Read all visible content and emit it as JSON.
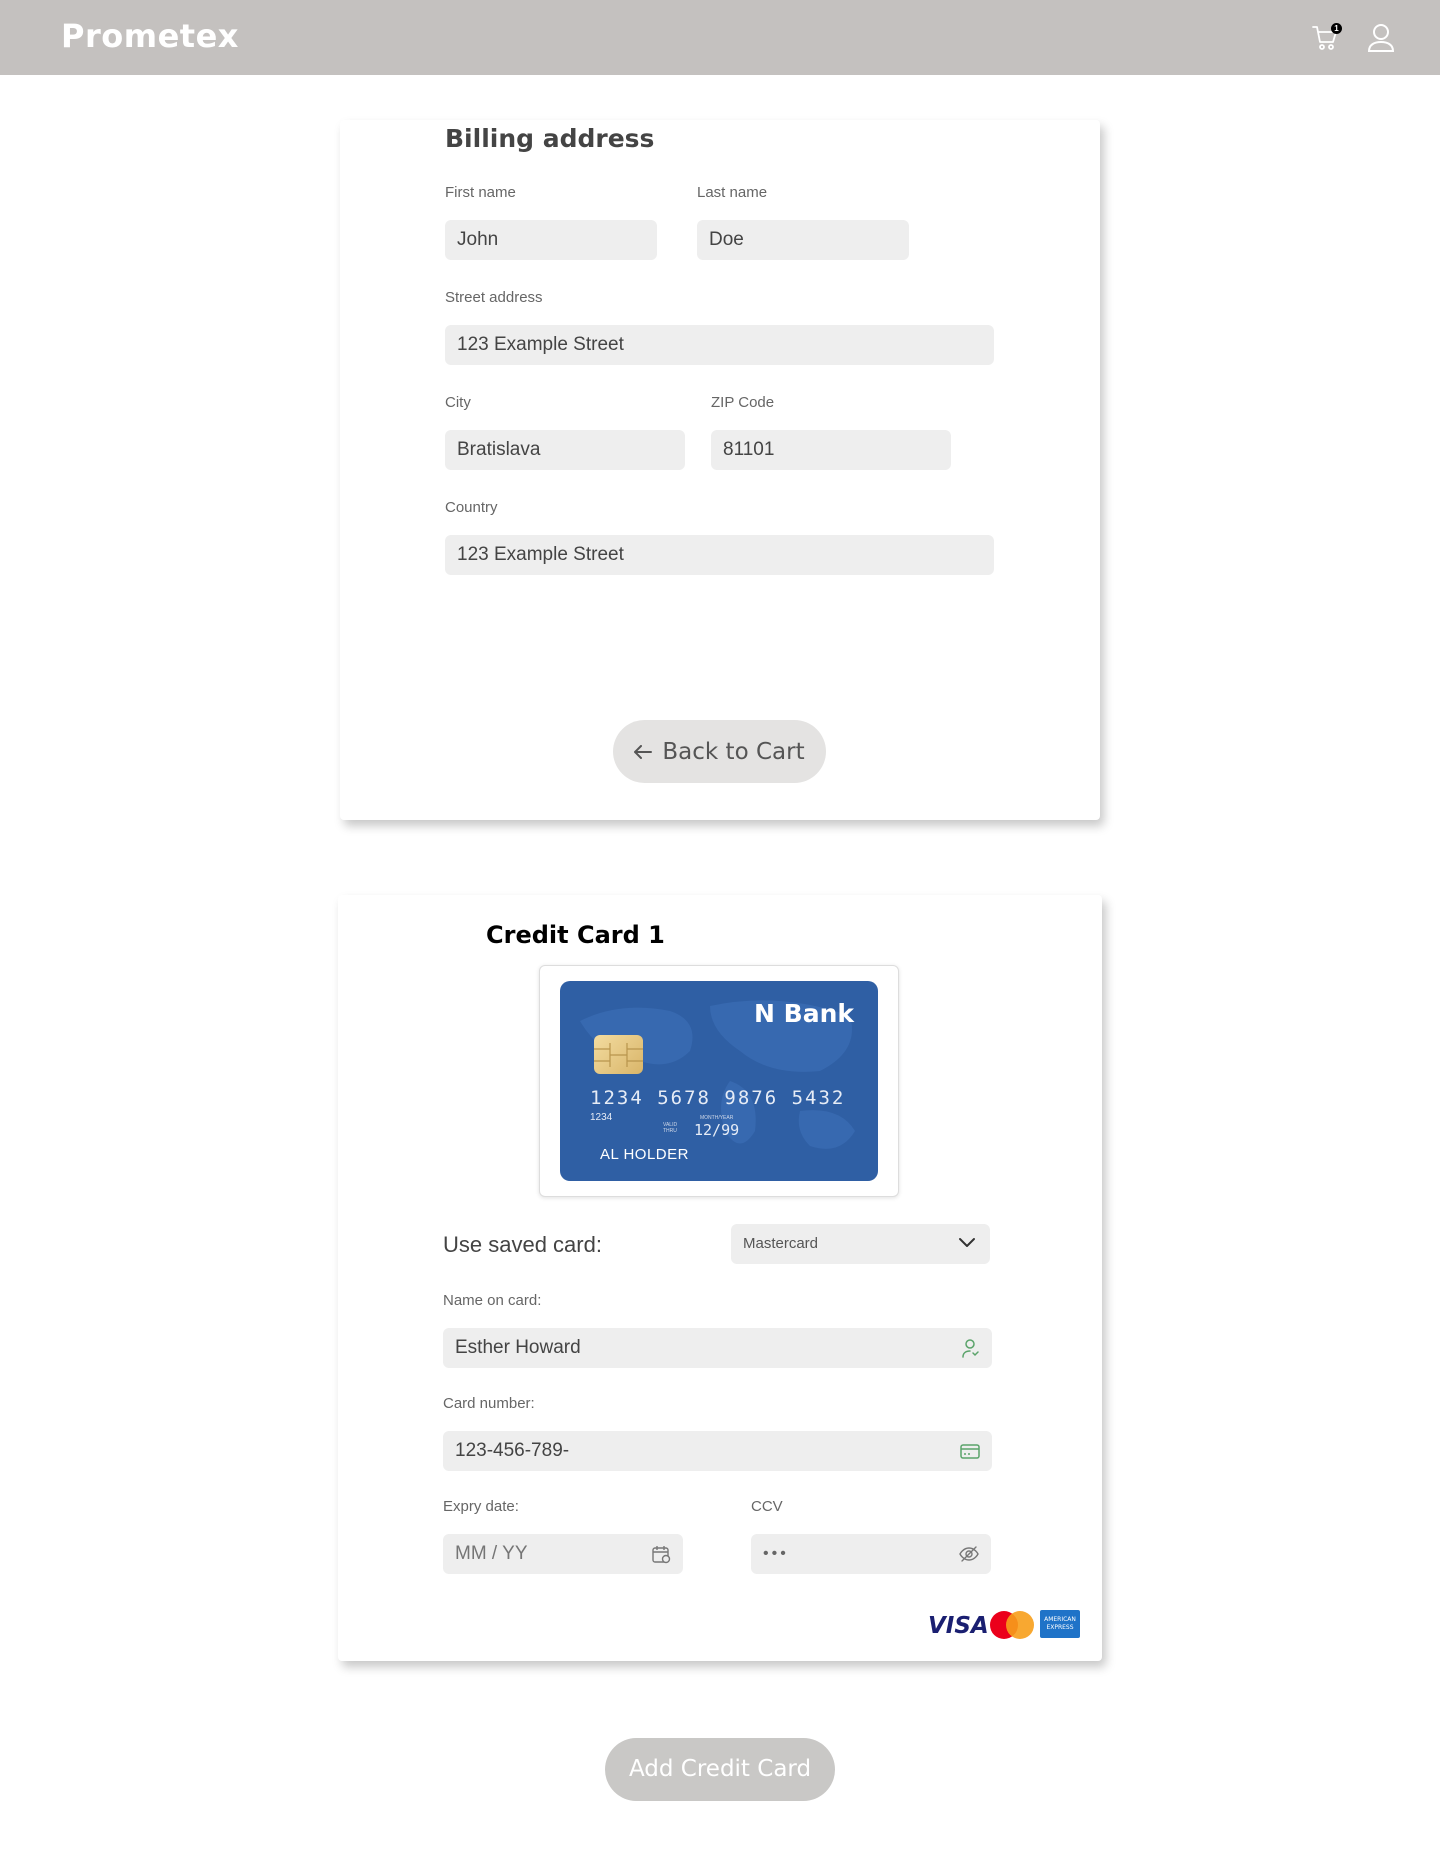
{
  "header": {
    "brand": "Prometex",
    "cart_count": "1",
    "cart_icon": "cart-icon",
    "user_icon": "user-icon"
  },
  "billing": {
    "title": "Billing address",
    "first_name_label": "First name",
    "first_name_value": "John",
    "last_name_label": "Last name",
    "last_name_value": "Doe",
    "street_label": "Street address",
    "street_value": "123 Example Street",
    "city_label": "City",
    "city_value": "Bratislava",
    "zip_label": "ZIP Code",
    "zip_value": "81101",
    "country_label": "Country",
    "country_value": "123 Example Street",
    "back_label": "Back to Cart"
  },
  "card_section": {
    "title": "Credit Card 1",
    "card_visual": {
      "bank": "N Bank",
      "number": "1234 5678 9876 5432",
      "sub_number": "1234",
      "valid_label_1": "VALID",
      "valid_label_2": "THRU",
      "month_year_label": "MONTH/YEAR",
      "expiry": "12/99",
      "holder": "AL  HOLDER"
    },
    "saved_label": "Use saved card:",
    "saved_value": "Mastercard",
    "name_label": "Name on card:",
    "name_value": "Esther Howard",
    "number_label": "Card number:",
    "number_value": "123-456-789-",
    "expiry_label": "Expry date:",
    "expiry_placeholder": "MM / YY",
    "ccv_label": "CCV",
    "ccv_value": "•••",
    "brands": {
      "visa": "VISA",
      "amex": "AMERICAN EXPRESS"
    }
  },
  "add_button": "Add Credit Card",
  "colors": {
    "topbar": "#c4c1bf",
    "field_bg": "#eeeeee",
    "card_blue": "#2f5fa4",
    "icon_green": "#5aa36a"
  }
}
